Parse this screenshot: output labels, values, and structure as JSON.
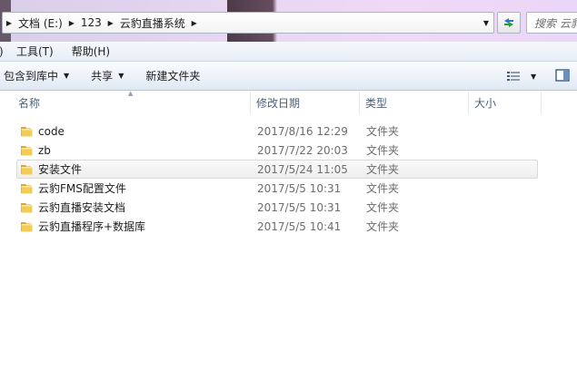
{
  "address": {
    "crumbs": [
      "文档 (E:)",
      "123",
      "云豹直播系统"
    ],
    "search_placeholder": "搜索 云豹"
  },
  "menu": {
    "edge": ")",
    "items": [
      "工具(T)",
      "帮助(H)"
    ]
  },
  "commands": {
    "include_library": "包含到库中",
    "share": "共享",
    "new_folder": "新建文件夹"
  },
  "columns": {
    "name": "名称",
    "modified": "修改日期",
    "type": "类型",
    "size": "大小"
  },
  "files": [
    {
      "name": "code",
      "modified": "2017/8/16 12:29",
      "type": "文件夹",
      "hover": false
    },
    {
      "name": "zb",
      "modified": "2017/7/22 20:03",
      "type": "文件夹",
      "hover": false
    },
    {
      "name": "安装文件",
      "modified": "2017/5/24 11:05",
      "type": "文件夹",
      "hover": true
    },
    {
      "name": "云豹FMS配置文件",
      "modified": "2017/5/5 10:31",
      "type": "文件夹",
      "hover": false
    },
    {
      "name": "云豹直播安装文档",
      "modified": "2017/5/5 10:31",
      "type": "文件夹",
      "hover": false
    },
    {
      "name": "云豹直播程序+数据库",
      "modified": "2017/5/5 10:41",
      "type": "文件夹",
      "hover": false
    }
  ],
  "icons": {
    "folder": "folder-icon",
    "refresh": "refresh-icon",
    "view": "view-details-icon",
    "preview": "preview-pane-icon"
  },
  "colors": {
    "folder_body": "#f2cc55",
    "folder_tab": "#d9a92a",
    "header_text": "#4c607a",
    "secondary_text": "#6d6d6d"
  }
}
